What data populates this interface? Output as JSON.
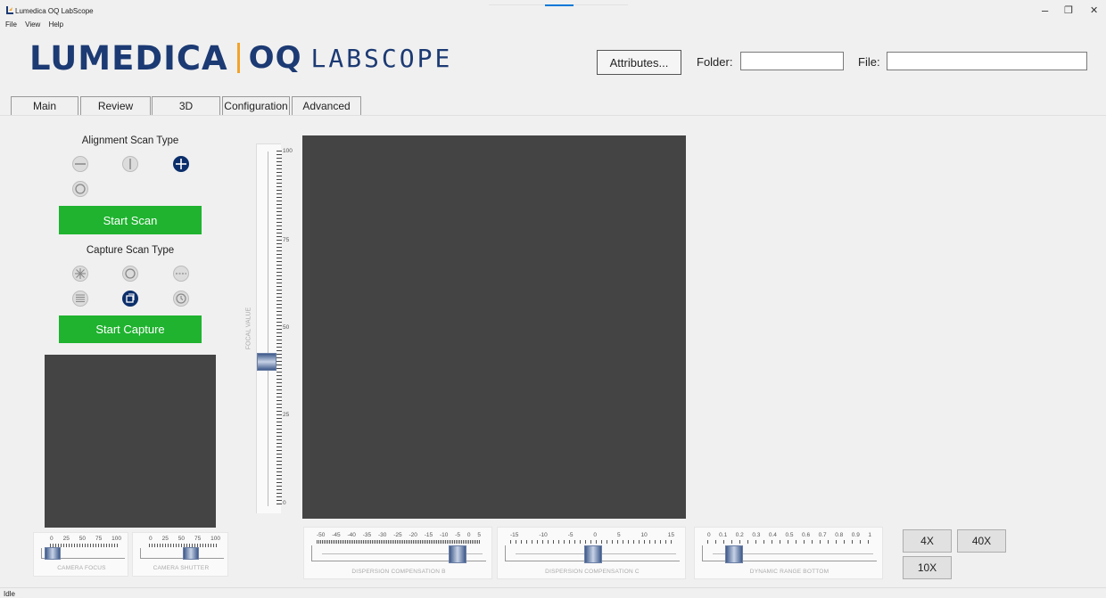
{
  "window": {
    "title": "Lumedica OQ LabScope",
    "minimize": "–",
    "restore": "❐",
    "close": "✕"
  },
  "menu": [
    "File",
    "View",
    "Help"
  ],
  "brand": {
    "lum": "LUMEDICA",
    "oq": "OQ",
    "lab": "LABSCOPE"
  },
  "header": {
    "attributes_label": "Attributes...",
    "folder_label": "Folder:",
    "folder_value": "",
    "file_label": "File:",
    "file_value": ""
  },
  "tabs": [
    "Main",
    "Review",
    "3D",
    "Configuration",
    "Advanced"
  ],
  "active_tab": "Main",
  "alignment": {
    "label": "Alignment Scan Type",
    "icons": [
      "horizontal-line-icon",
      "vertical-line-icon",
      "cross-icon",
      "circle-icon"
    ],
    "selected": "cross-icon",
    "start_label": "Start Scan"
  },
  "capture": {
    "label": "Capture Scan Type",
    "icons": [
      "star-icon",
      "ring-icon",
      "dashed-line-icon",
      "raster-icon",
      "volume-icon",
      "timer-icon"
    ],
    "selected": "volume-icon",
    "start_label": "Start Capture"
  },
  "focal": {
    "label": "FOCAL VALUE",
    "ticks": [
      "100",
      "75",
      "50",
      "25",
      "0"
    ],
    "value": 40
  },
  "sliders": {
    "camera_focus": {
      "label": "CAMERA FOCUS",
      "ticks": [
        "0",
        "25",
        "50",
        "75",
        "100"
      ],
      "value": 10
    },
    "camera_shutter": {
      "label": "CAMERA SHUTTER",
      "ticks": [
        "0",
        "25",
        "50",
        "75",
        "100"
      ],
      "value": 70
    },
    "dispersion_b": {
      "label": "DISPERSION COMPENSATION B",
      "ticks": [
        "-50",
        "-45",
        "-40",
        "-35",
        "-30",
        "-25",
        "-20",
        "-15",
        "-10",
        "-5",
        "0",
        "5"
      ],
      "value": 0
    },
    "dispersion_c": {
      "label": "DISPERSION COMPENSATION C",
      "ticks": [
        "-15",
        "-10",
        "-5",
        "0",
        "5",
        "10",
        "15"
      ],
      "value": 0
    },
    "dynamic_range": {
      "label": "DYNAMIC RANGE BOTTOM",
      "ticks": [
        "0",
        "0.1",
        "0.2",
        "0.3",
        "0.4",
        "0.5",
        "0.6",
        "0.7",
        "0.8",
        "0.9",
        "1"
      ],
      "value": 0.1
    }
  },
  "zoom": {
    "four": "4X",
    "forty": "40X",
    "ten": "10X"
  },
  "status": "Idle"
}
